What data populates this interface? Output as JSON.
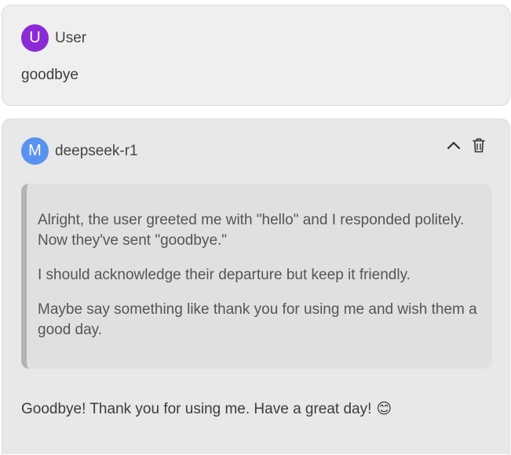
{
  "user_message": {
    "avatar_letter": "U",
    "avatar_color": "#8a2bd6",
    "sender": "User",
    "text": "goodbye"
  },
  "assistant_message": {
    "avatar_letter": "M",
    "avatar_color": "#5a92ef",
    "sender": "deepseek-r1",
    "icons": {
      "collapse": "chevron-up-icon",
      "delete": "trash-icon"
    },
    "thinking": [
      "Alright, the user greeted me with \"hello\" and I responded politely. Now they've sent \"goodbye.\"",
      "I should acknowledge their departure but keep it friendly.",
      "Maybe say something like thank you for using me and wish them a good day."
    ],
    "response": "Goodbye! Thank you for using me. Have a great day!",
    "response_emoji": "😊"
  }
}
